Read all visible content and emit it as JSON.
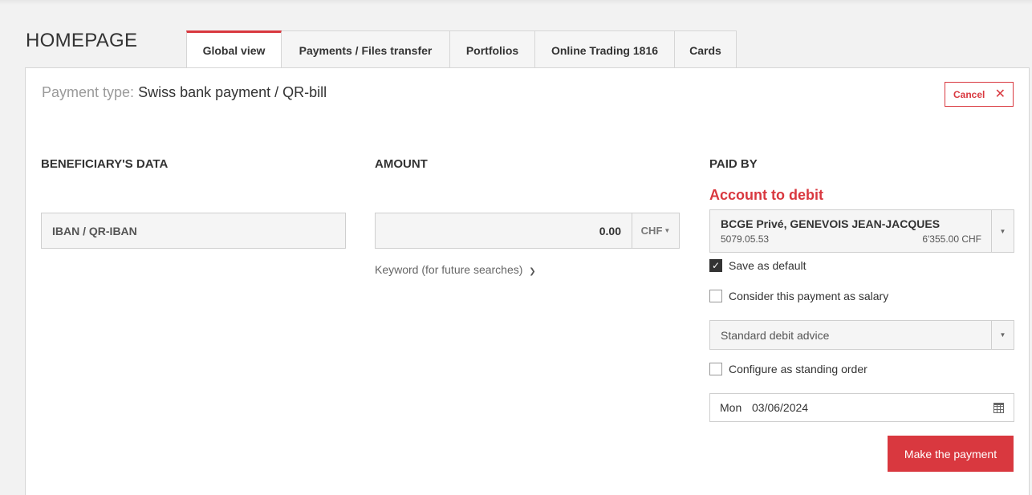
{
  "page": {
    "title": "HOMEPAGE"
  },
  "tabs": [
    {
      "label": "Global view",
      "active": true
    },
    {
      "label": "Payments / Files transfer",
      "active": false
    },
    {
      "label": "Portfolios",
      "active": false
    },
    {
      "label": "Online Trading 1816",
      "active": false
    },
    {
      "label": "Cards",
      "active": false
    }
  ],
  "payment": {
    "type_label": "Payment type:",
    "type_value": "Swiss bank payment / QR-bill",
    "cancel_label": "Cancel",
    "cancel_icon": "close-icon"
  },
  "beneficiary": {
    "heading": "BENEFICIARY'S DATA",
    "iban_placeholder": "IBAN / QR-IBAN",
    "iban_value": ""
  },
  "amount": {
    "heading": "AMOUNT",
    "value": "0.00",
    "currency": "CHF",
    "keyword_label": "Keyword (for future searches)"
  },
  "paid_by": {
    "heading": "PAID BY",
    "account_title": "Account to debit",
    "account": {
      "name": "BCGE Privé, GENEVOIS JEAN-JACQUES",
      "number": "5079.05.53",
      "balance": "6'355.00 CHF"
    },
    "save_default_label": "Save as default",
    "save_default_checked": true,
    "salary_label": "Consider this payment as salary",
    "salary_checked": false,
    "advice_value": "Standard debit advice",
    "standing_order_label": "Configure as standing order",
    "standing_order_checked": false,
    "date_day": "Mon",
    "date_value": "03/06/2024",
    "submit_label": "Make the payment"
  },
  "colors": {
    "accent": "#d9383f",
    "background": "#f2f2f2",
    "panel": "#ffffff"
  }
}
